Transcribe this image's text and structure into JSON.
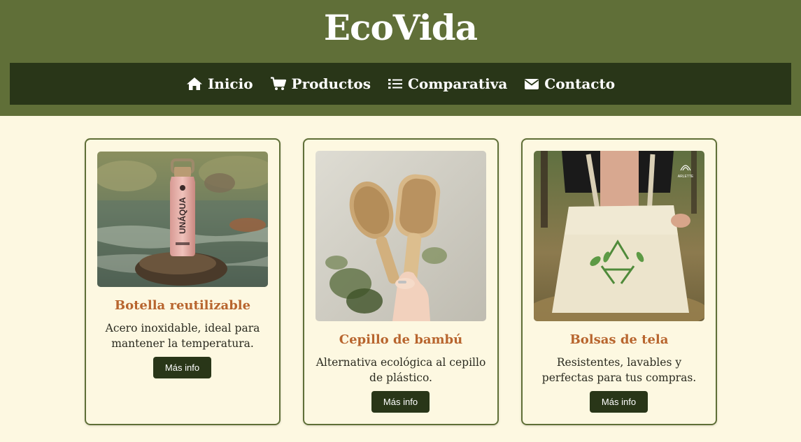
{
  "site": {
    "brand": "EcoVida"
  },
  "nav": {
    "items": [
      {
        "label": "Inicio",
        "icon": "home-icon"
      },
      {
        "label": "Productos",
        "icon": "cart-icon"
      },
      {
        "label": "Comparativa",
        "icon": "list-icon"
      },
      {
        "label": "Contacto",
        "icon": "envelope-icon"
      }
    ]
  },
  "products": [
    {
      "title": "Botella reutilizable",
      "description": "Acero inoxidable, ideal para mantener la temperatura.",
      "button_label": "Más info",
      "image": "pink-water-bottle-on-rock-photo",
      "image_text": "UNÁQUA"
    },
    {
      "title": "Cepillo de bambú",
      "description": "Alternativa ecológica al cepillo de plástico.",
      "button_label": "Más info",
      "image": "bamboo-hairbrushes-photo"
    },
    {
      "title": "Bolsas de tela",
      "description": "Resistentes, lavables y perfectas para tus compras.",
      "button_label": "Más info",
      "image": "cloth-tote-bag-recycle-photo",
      "image_text": "ARLETTE"
    }
  ],
  "colors": {
    "header_bg": "#606f38",
    "nav_bg": "#293618",
    "page_bg": "#fdf8e1",
    "title_accent": "#b8652e",
    "button_bg": "#293618"
  }
}
